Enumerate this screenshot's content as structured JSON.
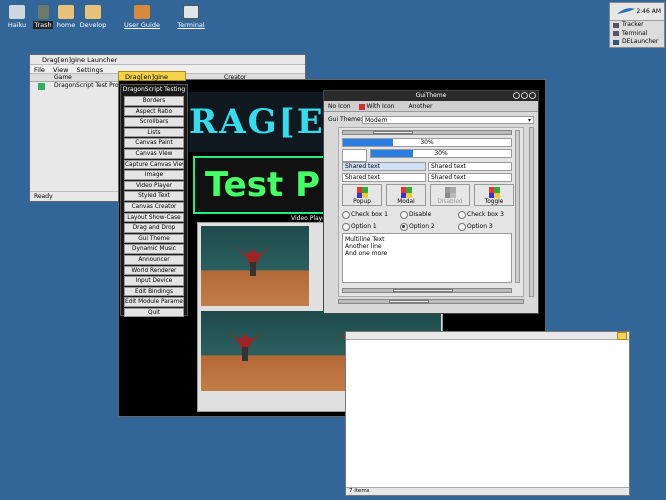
{
  "desktop": {
    "icons": [
      {
        "label": "Haiku",
        "color": "#cfd6de"
      },
      {
        "label": "Trash",
        "color": "#6b7a6b"
      },
      {
        "label": "home",
        "color": "#e9c27a"
      },
      {
        "label": "Develop",
        "color": "#e9c27a"
      },
      {
        "label": "User Guide",
        "color": "#d88a3a"
      },
      {
        "label": "Terminal",
        "color": "#dfe4ea"
      }
    ]
  },
  "deskbar": {
    "clock": "2:46 AM",
    "items": [
      "Tracker",
      "Terminal",
      "DELauncher"
    ]
  },
  "launcher": {
    "title": "Drag[en]gine Launcher",
    "menu": [
      "File",
      "View",
      "Settings"
    ],
    "columns": [
      "Game",
      "Creator"
    ],
    "rows": [
      "DragonScript Test Project"
    ],
    "status": "Ready"
  },
  "game_window": {
    "tab": "Drag[en]gine",
    "logo_text": "RAG[E",
    "banner_text": "Test P",
    "viewport_label": "Video Player"
  },
  "testing_menu": {
    "title": "DragonScript Testing",
    "items": [
      "Borders",
      "Aspect Ratio",
      "Scrollbars",
      "Lists",
      "Canvas Paint",
      "Canvas View",
      "Capture Canvas View",
      "Image",
      "Video Player",
      "Styled Text",
      "Canvas Creator",
      "Layout Show-Case",
      "Drag and Drop",
      "Gui Theme",
      "Dynamic Music",
      "Announcer",
      "World Renderer",
      "Input Device",
      "Edit Bindings",
      "Edit Module Parameters",
      "Quit"
    ]
  },
  "gui_theme": {
    "title": "GuiTheme",
    "tabs": [
      "No Icon",
      "With Icon",
      "Another"
    ],
    "theme_label": "Gui Theme:",
    "theme_value": "Modern",
    "progress": {
      "value1": "30%",
      "value2": "30%",
      "fill1": 0.3,
      "fill2": 0.3
    },
    "text_fields": [
      "Shared text",
      "Shared text",
      "Shared text",
      "Shared text"
    ],
    "buttons": [
      "Popup",
      "Modal",
      "Disabled",
      "Toggle"
    ],
    "checkboxes": [
      "Check box 1",
      "Disable",
      "Check box 3"
    ],
    "options": [
      "Option 1",
      "Option 2",
      "Option 3"
    ],
    "multiline": [
      "Multiline Text",
      "Another line",
      "And one more"
    ]
  },
  "tracker": {
    "status": "7 items"
  }
}
